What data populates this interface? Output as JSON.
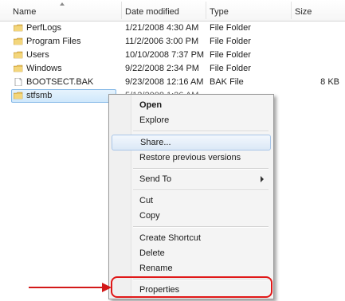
{
  "header": {
    "name": "Name",
    "date_modified": "Date modified",
    "type": "Type",
    "size": "Size"
  },
  "files": [
    {
      "name": "PerfLogs",
      "date": "1/21/2008 4:30 AM",
      "type": "File Folder",
      "size": "",
      "icon": "folder-icon"
    },
    {
      "name": "Program Files",
      "date": "11/2/2006 3:00 PM",
      "type": "File Folder",
      "size": "",
      "icon": "folder-icon"
    },
    {
      "name": "Users",
      "date": "10/10/2008 7:37 PM",
      "type": "File Folder",
      "size": "",
      "icon": "folder-icon"
    },
    {
      "name": "Windows",
      "date": "9/22/2008 2:34 PM",
      "type": "File Folder",
      "size": "",
      "icon": "folder-icon"
    },
    {
      "name": "BOOTSECT.BAK",
      "date": "9/23/2008 12:16 AM",
      "type": "BAK File",
      "size": "8 KB",
      "icon": "file-icon"
    },
    {
      "name": "stfsmb",
      "date": "",
      "type": "",
      "size": "",
      "icon": "folder-icon",
      "selected": true
    }
  ],
  "context_menu": {
    "items": [
      {
        "label": "Open",
        "bold": true
      },
      {
        "label": "Explore"
      },
      {
        "label": "Share...",
        "highlighted": true
      },
      {
        "label": "Restore previous versions"
      },
      {
        "label": "Send To",
        "submenu": true
      },
      {
        "label": "Cut"
      },
      {
        "label": "Copy"
      },
      {
        "label": "Create Shortcut"
      },
      {
        "label": "Delete"
      },
      {
        "label": "Rename"
      },
      {
        "label": "Properties",
        "annotated": true
      }
    ]
  },
  "colors": {
    "annotation": "#e01818",
    "selection": "#cfe8fb",
    "folder": "#e8c25a"
  }
}
